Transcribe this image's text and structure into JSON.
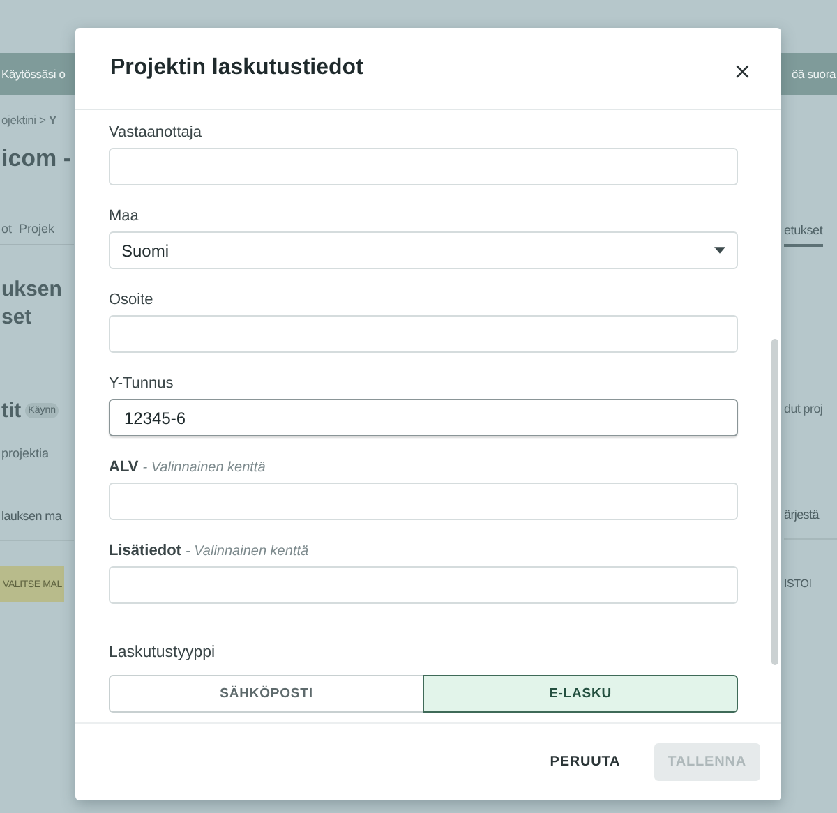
{
  "background": {
    "banner": {
      "left": "Käytössäsi o",
      "right": "öä suora"
    },
    "breadcrumb": "ojektini > **Y**",
    "title": "icom -",
    "tabs": [
      {
        "label": "ot",
        "selected": false
      },
      {
        "label": "Projek",
        "selected": false
      },
      {
        "label": "etukset",
        "selected": true
      }
    ],
    "section_title": [
      "uksen",
      "set"
    ],
    "list_title": "tit",
    "status_badge": "Käynn",
    "list_right": "dut proj",
    "list_subtitle": "projektia",
    "sort_label": "lauksen ma",
    "sort_right": "ärjestä",
    "buttons": [
      {
        "label": "VALITSE MAL",
        "kind": "primary"
      },
      {
        "label": "ISTOI",
        "kind": "text"
      }
    ]
  },
  "dialog": {
    "title": "Projektin laskutustiedot",
    "close": "×",
    "fields": [
      {
        "kind": "text",
        "label": "Vastaanottaja",
        "focused": false
      },
      {
        "kind": "select",
        "label": "Maa",
        "value": "Suomi",
        "focused": false
      },
      {
        "kind": "text",
        "label": "Osoite",
        "focused": false
      },
      {
        "kind": "text",
        "label": "Y-Tunnus",
        "value": "12345-6",
        "focused": true
      },
      {
        "kind": "text",
        "label": "ALV",
        "note": "- Valinnainen kenttä",
        "focused": false
      },
      {
        "kind": "text",
        "label": "Lisätiedot",
        "note": "- Valinnainen kenttä",
        "focused": false
      }
    ],
    "billing_type": {
      "label": "Laskutustyyppi",
      "options": [
        {
          "label": "SÄHKÖPOSTI",
          "selected": false
        },
        {
          "label": "E-LASKU",
          "selected": true
        }
      ]
    },
    "buttons": [
      {
        "label": "PERUUTA",
        "kind": "text",
        "disabled": false
      },
      {
        "label": "TALLENNA",
        "kind": "primary",
        "disabled": true
      }
    ]
  }
}
